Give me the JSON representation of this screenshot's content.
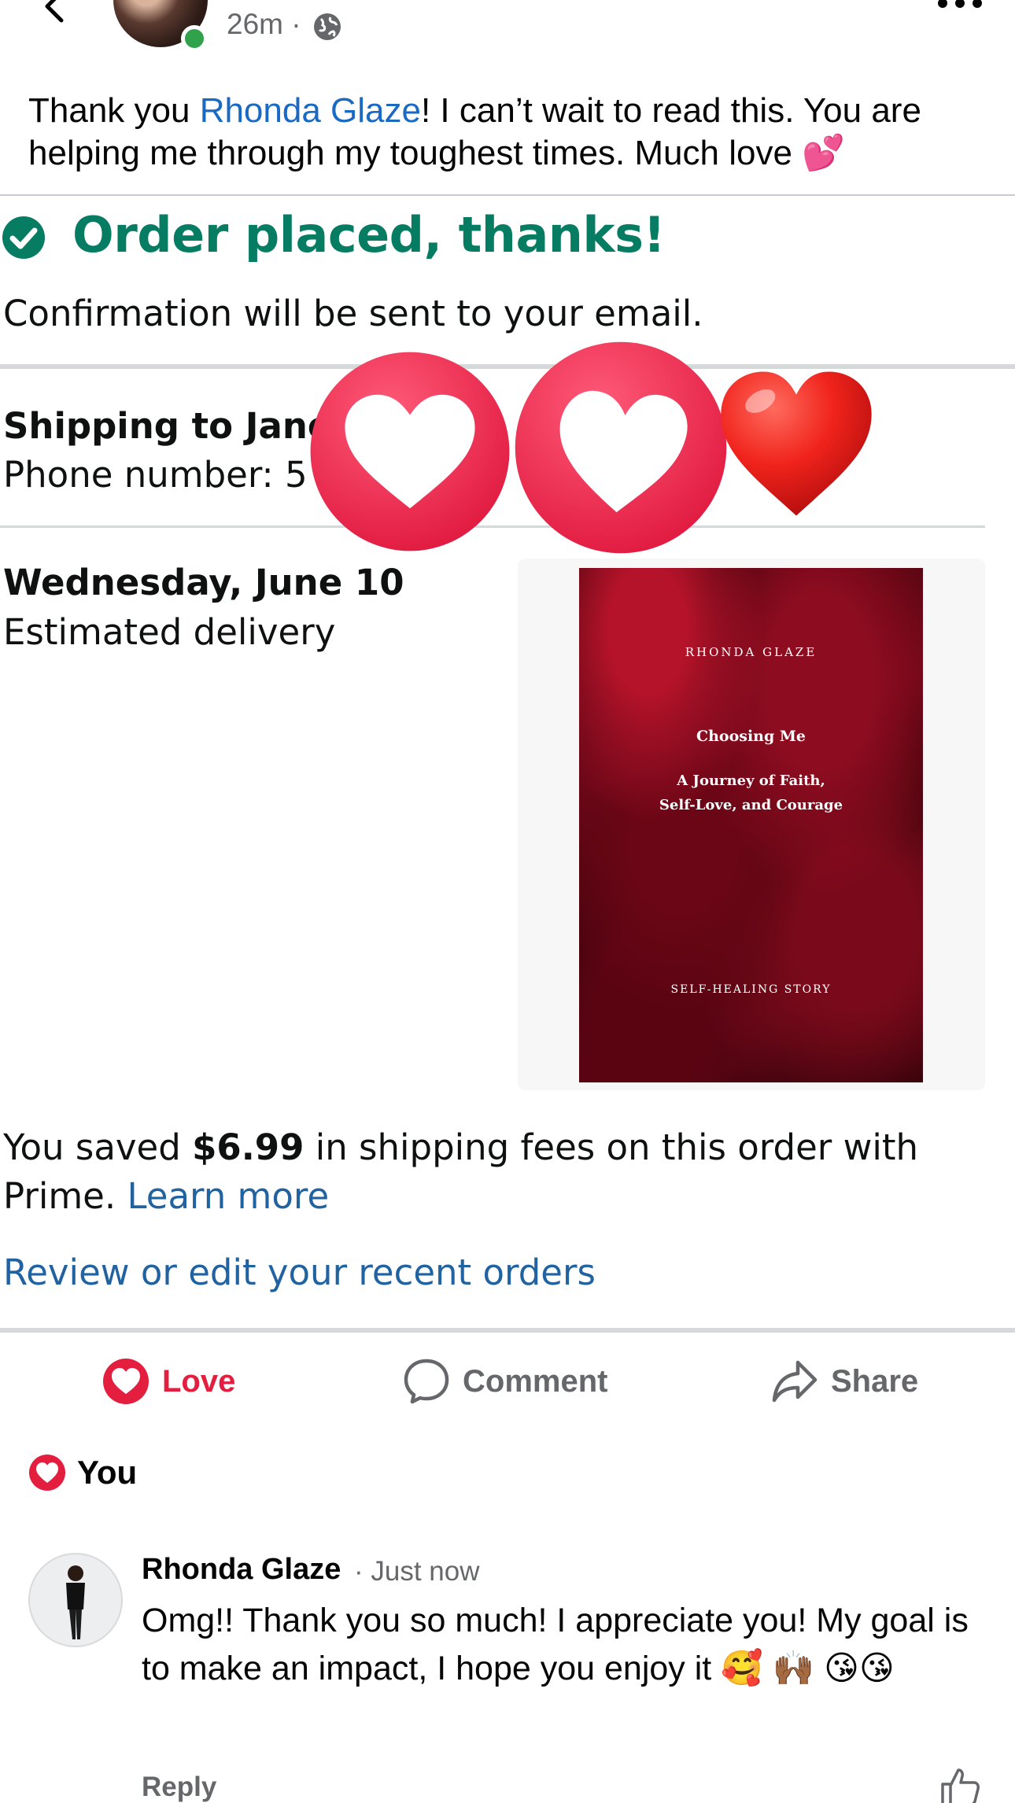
{
  "header": {
    "time": "26m ·",
    "back_icon": "chevron-left-icon",
    "audience_icon": "globe-icon",
    "more_icon": "more-horizontal-icon"
  },
  "post": {
    "text_before": "Thank you ",
    "mention": "Rhonda Glaze",
    "text_after": "!  I can’t wait to read this. You are helping me through my toughest times. Much love 💕"
  },
  "amazon": {
    "order_title": "Order placed, thanks!",
    "confirmation": "Confirmation will be sent to your email.",
    "shipping_to": "Shipping to Jane",
    "phone": "Phone number: 5",
    "delivery_date": "Wednesday, June 10",
    "delivery_label": "Estimated delivery",
    "saved_prefix": "You saved ",
    "saved_amount": "$6.99",
    "saved_suffix": " in shipping fees on this order with Prime. ",
    "learn_more": "Learn more",
    "review_link": "Review or edit your recent orders",
    "colors": {
      "success": "#067d62",
      "link": "#2162a1"
    }
  },
  "book": {
    "author": "RHONDA GLAZE",
    "title": "Choosing Me",
    "subtitle_line1": "A Journey of Faith,",
    "subtitle_line2": "Self-Love, and Courage",
    "footer": "SELF-HEALING STORY"
  },
  "actions": {
    "love": "Love",
    "comment": "Comment",
    "share": "Share",
    "love_color": "#e41e3f"
  },
  "reactions": {
    "you": "You"
  },
  "comment": {
    "author": "Rhonda Glaze",
    "time": "· Just now",
    "text": "Omg!! Thank you so much! I appreciate you! My goal is to make an impact, I hope you enjoy it  🥰 🙌🏾 😘😘",
    "reply": "Reply"
  }
}
